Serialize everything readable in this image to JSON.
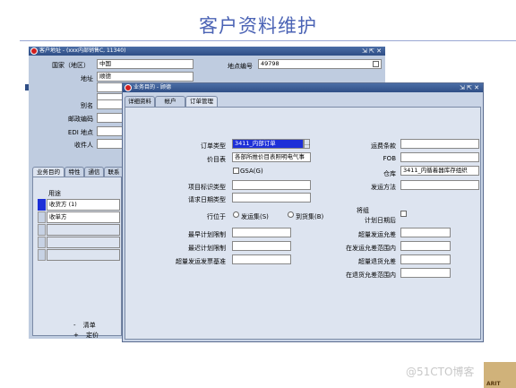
{
  "slide": {
    "title": "客户资料维护"
  },
  "back": {
    "title": "客户地址 - (xxx内部销售C, 11340)",
    "ctrl": "⇲ ⇱ ✕",
    "country_label": "国家（地区）",
    "country": "中国",
    "site_no_label": "地点编号",
    "site_no": "49798",
    "addr_label": "地址",
    "addr": "顺德",
    "alias_label": "别名",
    "postal_label": "邮政编码",
    "edi_label": "EDI 地点",
    "recv_label": "收件人",
    "tabs": [
      "业务目的",
      "特性",
      "通信",
      "联系"
    ],
    "usage_header": "用途",
    "usage": [
      "收货方 (1)",
      "收单方"
    ],
    "tree": [
      {
        "sign": "-",
        "text": "清单"
      },
      {
        "sign": "+",
        "text": "定价"
      }
    ]
  },
  "front": {
    "title": "业务目的 - 顾德",
    "ctrl": "⇲ ⇱ ✕",
    "tabs": [
      "详细资料",
      "帐户",
      "订单管理"
    ],
    "order_type_label": "订单类型",
    "order_type": "3411_内部订单",
    "price_list_label": "价目表",
    "price_list": "各部所推价目表照明电气事",
    "gsa_label": "GSA(G)",
    "item_id_type_label": "项目标识类型",
    "req_date_type_label": "请求日期类型",
    "line_label": "行位于",
    "ship_set_label": "发运集(S)",
    "arrival_set_label": "到货集(B)",
    "earliest_label": "最早计划限制",
    "latest_label": "最迟计划限制",
    "over_ship_basis_label": "超量发运发票基准",
    "freight_label": "运费条款",
    "fob_label": "FOB",
    "warehouse_label": "仓库",
    "warehouse": "3411_内循着器库存组织",
    "ship_method_label": "发运方法",
    "group_label": "将组",
    "after_date_label": "计划日期后",
    "over_ship_tol_label": "超量发运允差",
    "in_ship_range_label": "在发运允差范围内",
    "over_return_tol_label": "超量退货允差",
    "in_return_range_label": "在退货允差范围内"
  },
  "watermark": "@51CTO博客",
  "logo_text": "ARIT"
}
